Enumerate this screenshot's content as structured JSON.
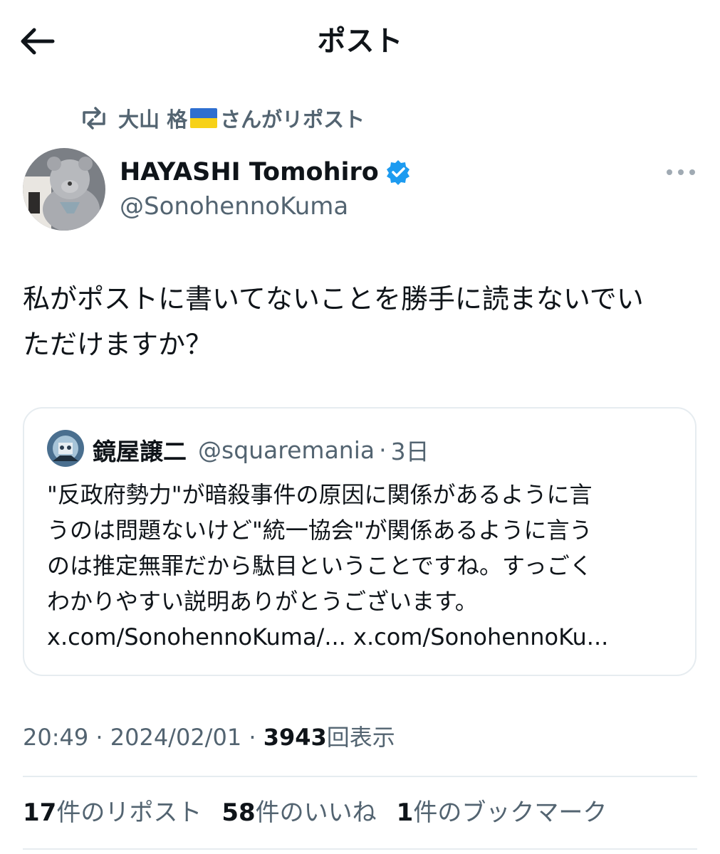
{
  "header": {
    "title": "ポスト",
    "back_icon": "arrow-left-icon"
  },
  "repost": {
    "reposter_name": "大山 格",
    "suffix": "さんがリポスト",
    "icon": "repost-icon",
    "flag_colors": [
      "#2f6fd0",
      "#f7d117"
    ]
  },
  "author": {
    "name": "HAYASHI Tomohiro",
    "handle": "@SonohennoKuma",
    "verified_color": "#1d9bf0"
  },
  "tweet": {
    "text_line1": "私がポストに書いてないことを勝手に読まないでい",
    "text_line2": "ただけますか？"
  },
  "quote": {
    "name": "鏡屋譲二",
    "handle": "@squaremania",
    "dot": "·",
    "time": "3日",
    "lines": [
      "\"反政府勢力\"が暗殺事件の原因に関係があるように言",
      "うのは問題ないけど\"統一協会\"が関係あるように言う",
      "のは推定無罪だから駄目ということですね。すっごく",
      "わかりやすい説明ありがとうございます。"
    ],
    "links": "x.com/SonohennoKuma/... x.com/SonohennoKu..."
  },
  "meta": {
    "time": "20:49",
    "sep1": " · ",
    "date": "2024/02/01",
    "sep2": " · ",
    "views": "3943",
    "views_label": "回表示"
  },
  "stats": {
    "reposts_num": "17",
    "reposts_label": "件のリポスト",
    "likes_num": "58",
    "likes_label": "件のいいね",
    "bookmarks_num": "1",
    "bookmarks_label": "件のブックマーク"
  },
  "colors": {
    "text": "#0f1419",
    "secondary": "#536471",
    "border": "#e6ecf0"
  }
}
